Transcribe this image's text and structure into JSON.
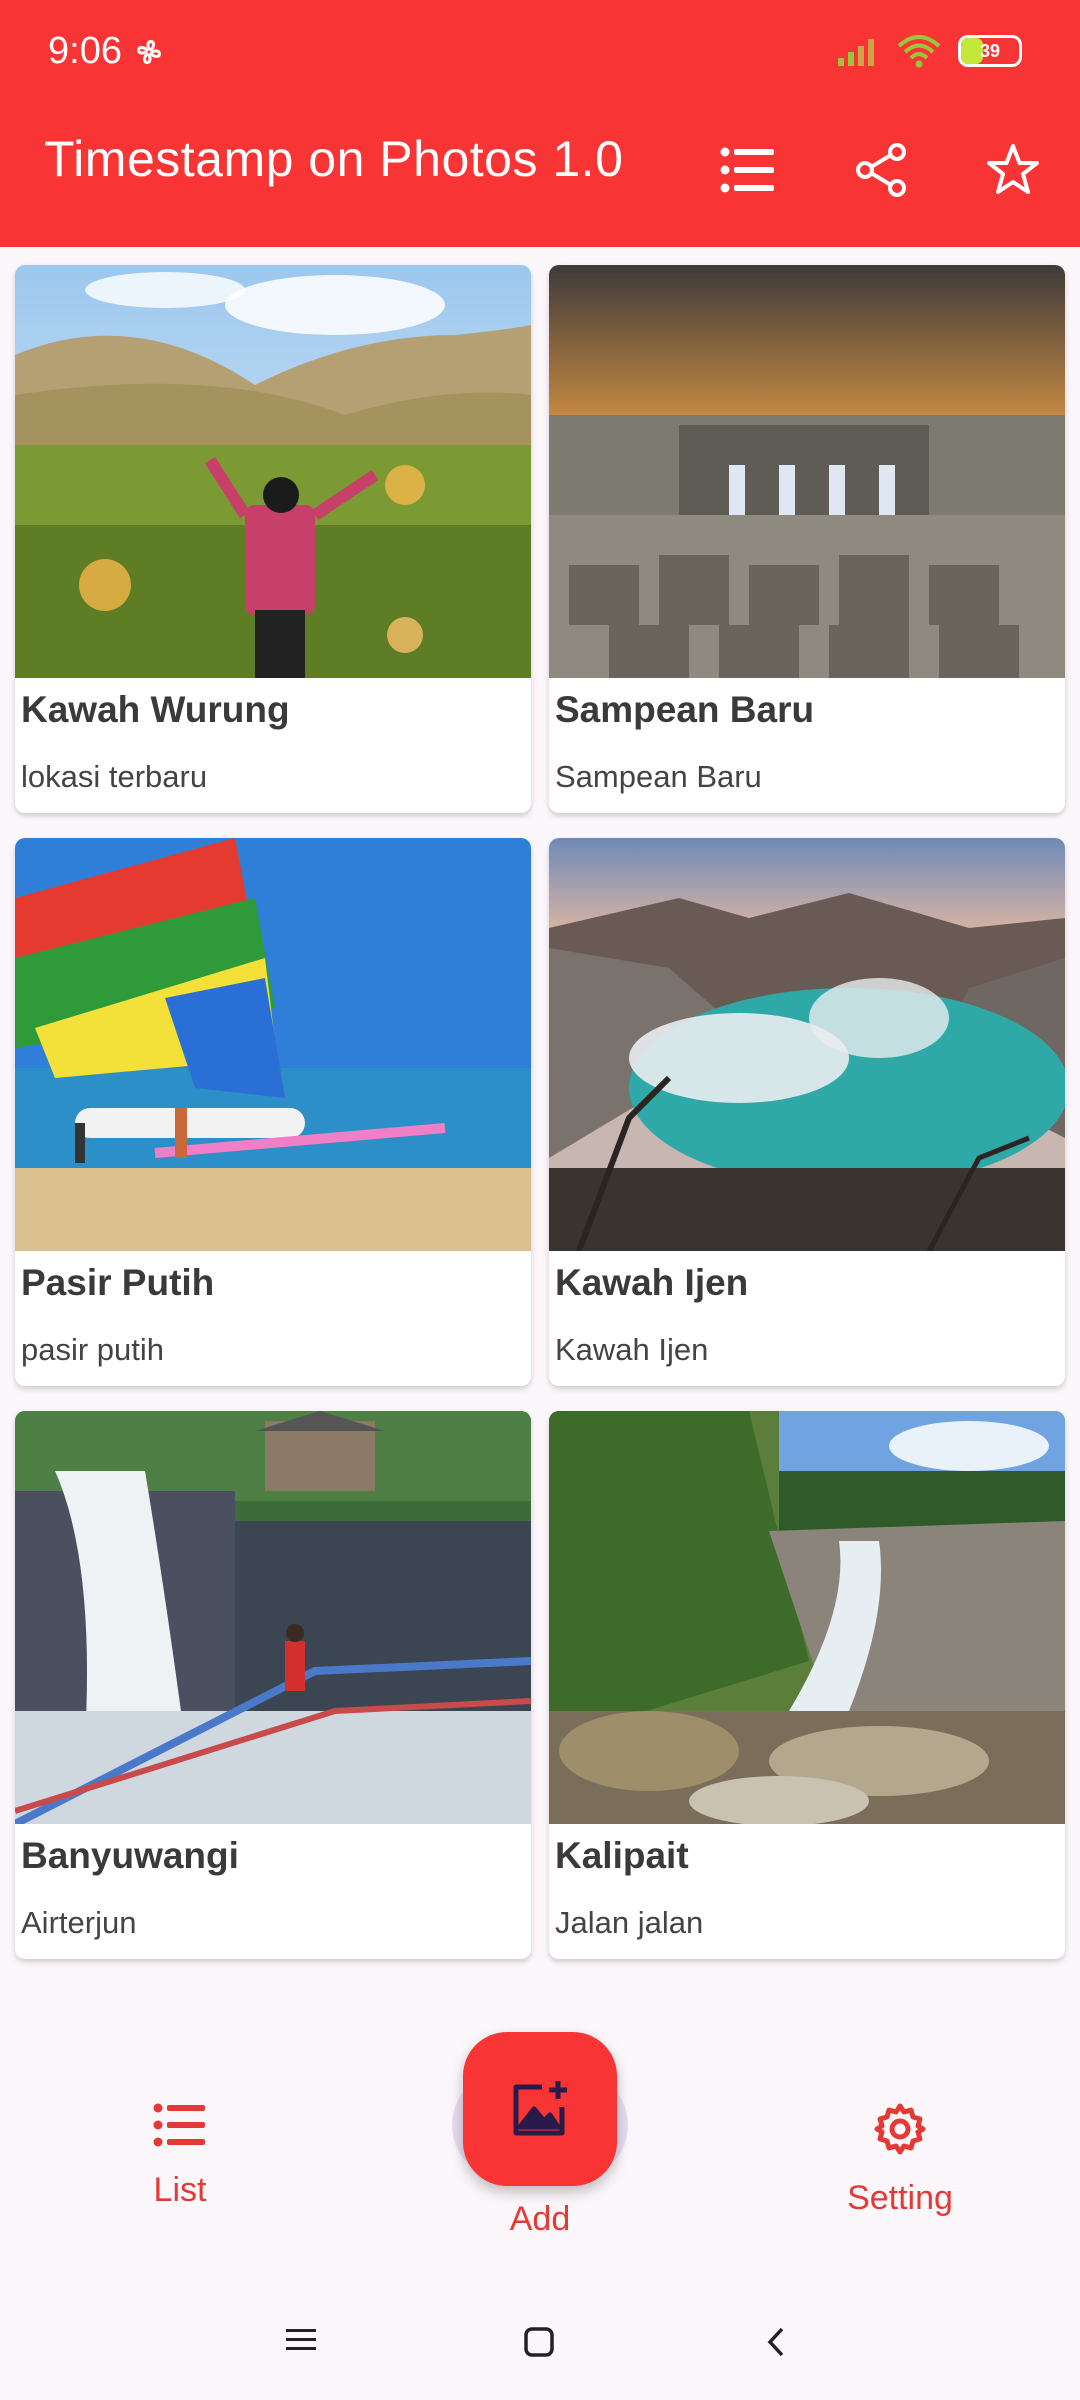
{
  "status_bar": {
    "time": "9:06",
    "battery": "39"
  },
  "app_bar": {
    "title": "Timestamp on Photos 1.0",
    "actions": [
      "list-icon",
      "share-icon",
      "star-icon"
    ]
  },
  "cards": [
    {
      "title": "Kawah Wurung",
      "subtitle": "lokasi terbaru"
    },
    {
      "title": "Sampean Baru",
      "subtitle": "Sampean Baru"
    },
    {
      "title": "Pasir Putih",
      "subtitle": "pasir putih"
    },
    {
      "title": "Kawah Ijen",
      "subtitle": "Kawah Ijen"
    },
    {
      "title": "Banyuwangi",
      "subtitle": "Airterjun"
    },
    {
      "title": "Kalipait",
      "subtitle": "Jalan jalan"
    }
  ],
  "bottom_nav": {
    "list_label": "List",
    "add_label": "Add",
    "setting_label": "Setting"
  },
  "colors": {
    "primary": "#f83434",
    "nav_accent": "#e53935"
  }
}
